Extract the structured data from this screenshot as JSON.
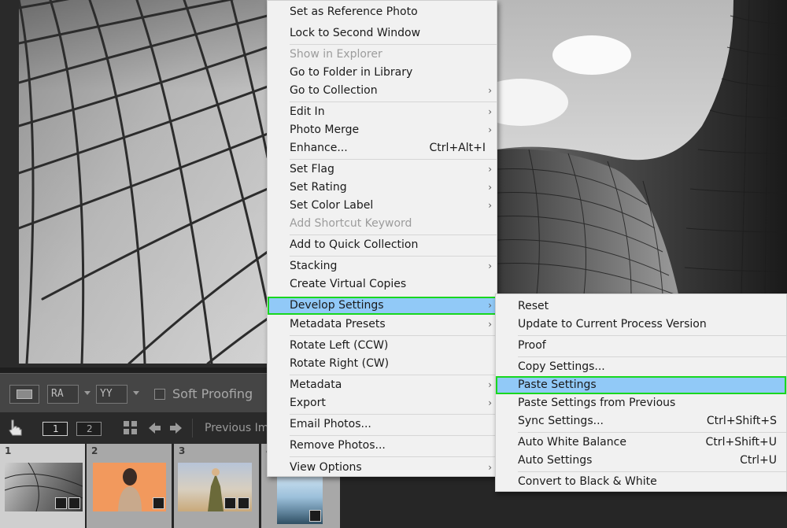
{
  "toolbar": {
    "soft_proofing_label": "Soft Proofing",
    "icon_ra": "RA",
    "icon_yy": "YY",
    "view_1": "1",
    "view_2": "2",
    "previous_label": "Previous Im"
  },
  "filmstrip": {
    "cells": [
      {
        "number": "1"
      },
      {
        "number": "2"
      },
      {
        "number": "3"
      },
      {
        "number": "4"
      }
    ]
  },
  "context_menu": {
    "items": [
      {
        "label": "Set as Reference Photo"
      },
      {
        "label": "Lock to Second Window"
      },
      {
        "label": "Show in Explorer",
        "disabled": true
      },
      {
        "label": "Go to Folder in Library"
      },
      {
        "label": "Go to Collection",
        "submenu": true
      },
      {
        "label": "Edit In",
        "submenu": true
      },
      {
        "label": "Photo Merge",
        "submenu": true
      },
      {
        "label": "Enhance...",
        "shortcut": "Ctrl+Alt+I"
      },
      {
        "label": "Set Flag",
        "submenu": true
      },
      {
        "label": "Set Rating",
        "submenu": true
      },
      {
        "label": "Set Color Label",
        "submenu": true
      },
      {
        "label": "Add Shortcut Keyword",
        "disabled": true
      },
      {
        "label": "Add to Quick Collection"
      },
      {
        "label": "Stacking",
        "submenu": true
      },
      {
        "label": "Create Virtual Copies"
      },
      {
        "label": "Develop Settings",
        "submenu": true,
        "highlighted": true
      },
      {
        "label": "Metadata Presets",
        "submenu": true
      },
      {
        "label": "Rotate Left (CCW)"
      },
      {
        "label": "Rotate Right (CW)"
      },
      {
        "label": "Metadata",
        "submenu": true
      },
      {
        "label": "Export",
        "submenu": true
      },
      {
        "label": "Email Photos..."
      },
      {
        "label": "Remove Photos..."
      },
      {
        "label": "View Options",
        "submenu": true
      }
    ]
  },
  "develop_submenu": {
    "items": [
      {
        "label": "Reset"
      },
      {
        "label": "Update to Current Process Version"
      },
      {
        "label": "Proof"
      },
      {
        "label": "Copy Settings..."
      },
      {
        "label": "Paste Settings",
        "highlighted": true
      },
      {
        "label": "Paste Settings from Previous"
      },
      {
        "label": "Sync Settings...",
        "shortcut": "Ctrl+Shift+S"
      },
      {
        "label": "Auto White Balance",
        "shortcut": "Ctrl+Shift+U"
      },
      {
        "label": "Auto Settings",
        "shortcut": "Ctrl+U"
      },
      {
        "label": "Convert to Black & White"
      }
    ]
  },
  "colors": {
    "highlight_fill": "#91c9f7",
    "highlight_outline": "#19d71f",
    "menu_bg": "#f1f1f1"
  }
}
